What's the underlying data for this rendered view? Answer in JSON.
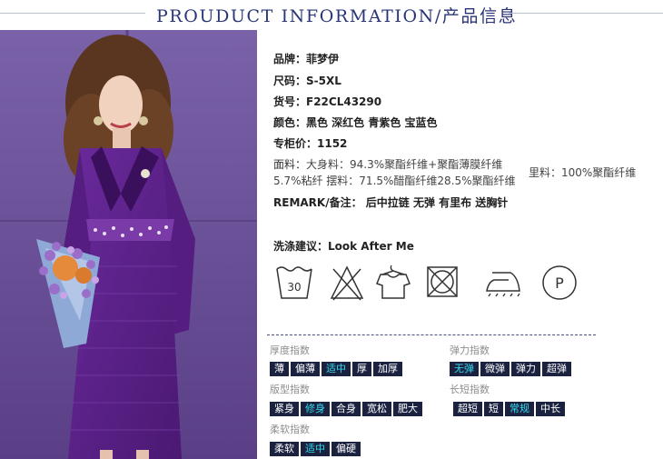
{
  "header": {
    "title": "PROUDUCT INFORMATION/产品信息"
  },
  "info": {
    "brand": "品牌：菲梦伊",
    "size": "尺码：S-5XL",
    "sku": "货号：F22CL43290",
    "color": "颜色：黑色 深红色 青紫色 宝蓝色",
    "price": "专柜价：1152",
    "fabric_label": "面料：",
    "fabric_main": "大身料：94.3%聚酯纤维+聚酯薄膜纤维",
    "fabric_sub": "5.7%粘纤 摆料：71.5%醋酯纤维28.5%聚酯纤维",
    "lining": "里料：100%聚酯纤维",
    "remark": "REMARK/备注： 后中拉链 无弹 有里布 送胸针"
  },
  "care": {
    "title": "洗涤建议：Look After Me",
    "icons": [
      "wash-30-icon",
      "no-bleach-icon",
      "hang-dry-icon",
      "no-tumble-dry-icon",
      "iron-icon",
      "dry-clean-p-icon"
    ],
    "wash_temp": "30",
    "dryclean_letter": "P"
  },
  "indices": {
    "thickness": {
      "title": "厚度指数",
      "options": [
        "薄",
        "偏薄",
        "适中",
        "厚",
        "加厚"
      ],
      "selected": 2
    },
    "elasticity": {
      "title": "弹力指数",
      "options": [
        "无弹",
        "微弹",
        "弹力",
        "超弹"
      ],
      "selected": 0
    },
    "fit": {
      "title": "版型指数",
      "options": [
        "紧身",
        "修身",
        "合身",
        "宽松",
        "肥大"
      ],
      "selected": 1
    },
    "length": {
      "title": "长短指数",
      "options": [
        "超短",
        "短",
        "常规",
        "中长"
      ],
      "selected": 2
    },
    "softness": {
      "title": "柔软指数",
      "options": [
        "柔软",
        "适中",
        "偏硬"
      ],
      "selected": 1
    }
  },
  "colors": {
    "chip_bg": "#1b2240",
    "chip_selected_text": "#33dcef",
    "title": "#2a3576",
    "dress": "#5a1f87"
  }
}
